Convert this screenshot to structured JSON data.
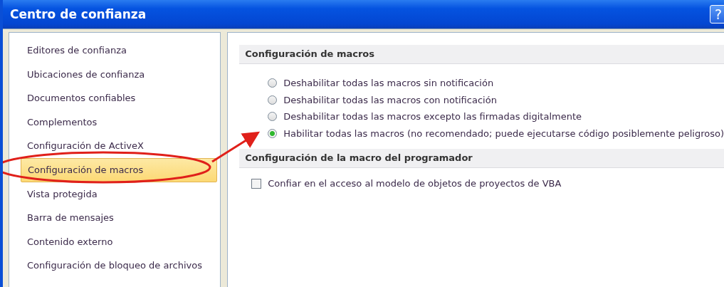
{
  "window": {
    "title": "Centro de confianza",
    "help_button": "?"
  },
  "sidebar": {
    "items": [
      {
        "label": "Editores de confianza",
        "selected": false
      },
      {
        "label": "Ubicaciones de confianza",
        "selected": false
      },
      {
        "label": "Documentos confiables",
        "selected": false
      },
      {
        "label": "Complementos",
        "selected": false
      },
      {
        "label": "Configuración de ActiveX",
        "selected": false
      },
      {
        "label": "Configuración de macros",
        "selected": true
      },
      {
        "label": "Vista protegida",
        "selected": false
      },
      {
        "label": "Barra de mensajes",
        "selected": false
      },
      {
        "label": "Contenido externo",
        "selected": false
      },
      {
        "label": "Configuración de bloqueo de archivos",
        "selected": false
      }
    ]
  },
  "sections": [
    {
      "title": "Configuración de macros",
      "kind": "radio",
      "options": [
        {
          "label": "Deshabilitar todas las macros sin notificación",
          "selected": false
        },
        {
          "label": "Deshabilitar todas las macros con notificación",
          "selected": false
        },
        {
          "label": "Deshabilitar todas las macros excepto las firmadas digitalmente",
          "selected": false
        },
        {
          "label": "Habilitar todas las macros (no recomendado; puede ejecutarse código posiblemente peligroso)",
          "selected": true
        }
      ]
    },
    {
      "title": "Configuración de la macro del programador",
      "kind": "checkbox",
      "options": [
        {
          "label": "Confiar en el acceso al modelo de objetos de proyectos de VBA",
          "checked": false
        }
      ]
    }
  ]
}
